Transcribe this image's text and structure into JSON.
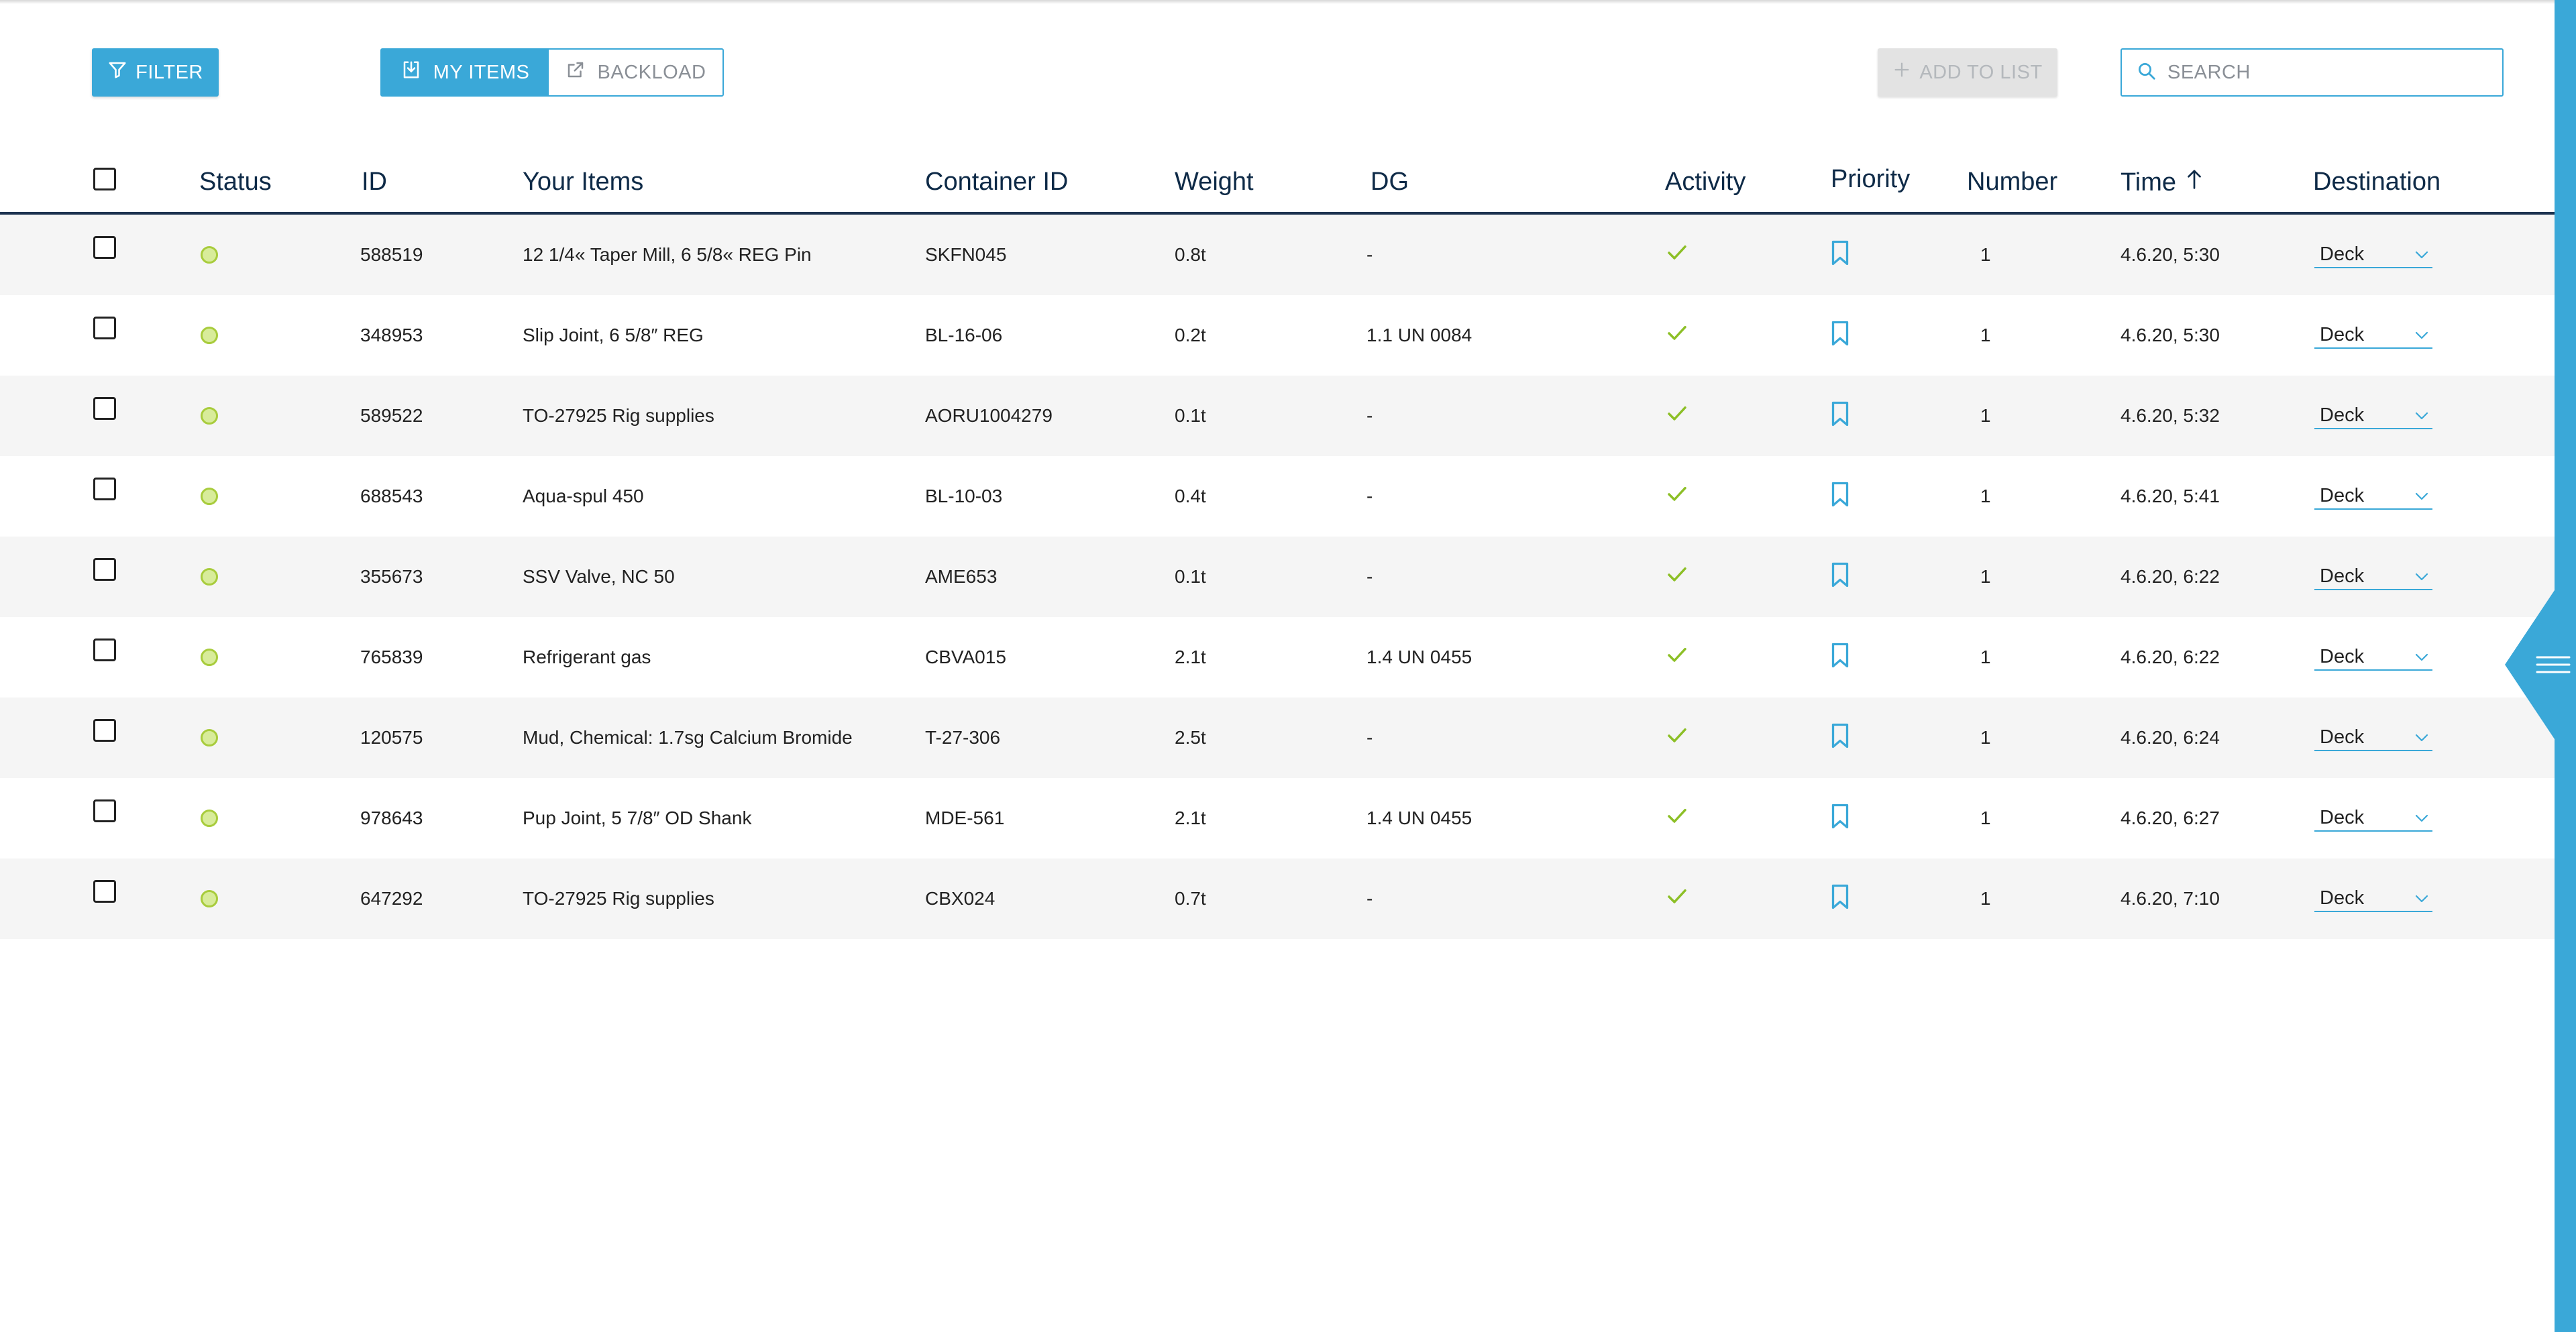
{
  "toolbar": {
    "filter_label": "FILTER",
    "my_items_label": "MY ITEMS",
    "backload_label": "BACKLOAD",
    "add_to_list_label": "ADD TO LIST",
    "search_placeholder": "SEARCH"
  },
  "table": {
    "headers": {
      "status": "Status",
      "id": "ID",
      "items": "Your Items",
      "container": "Container ID",
      "weight": "Weight",
      "dg": "DG",
      "activity": "Activity",
      "priority": "Priority",
      "number": "Number",
      "time": "Time",
      "destination": "Destination"
    },
    "sort": {
      "column": "time",
      "direction": "ascending",
      "icon": "arrow-up-icon"
    },
    "rows": [
      {
        "id": "588519",
        "item": "12 1/4« Taper Mill, 6 5/8« REG Pin",
        "container": "SKFN045",
        "weight": "0.8t",
        "dg": "-",
        "number": "1",
        "time": "4.6.20, 5:30",
        "destination": "Deck"
      },
      {
        "id": "348953",
        "item": "Slip Joint, 6 5/8″ REG",
        "container": "BL-16-06",
        "weight": "0.2t",
        "dg": "1.1 UN 0084",
        "number": "1",
        "time": "4.6.20, 5:30",
        "destination": "Deck"
      },
      {
        "id": "589522",
        "item": "TO-27925 Rig supplies",
        "container": "AORU1004279",
        "weight": "0.1t",
        "dg": "-",
        "number": "1",
        "time": "4.6.20, 5:32",
        "destination": "Deck"
      },
      {
        "id": "688543",
        "item": "Aqua-spul 450",
        "container": "BL-10-03",
        "weight": "0.4t",
        "dg": "-",
        "number": "1",
        "time": "4.6.20, 5:41",
        "destination": "Deck"
      },
      {
        "id": "355673",
        "item": "SSV Valve, NC 50",
        "container": "AME653",
        "weight": "0.1t",
        "dg": "-",
        "number": "1",
        "time": "4.6.20, 6:22",
        "destination": "Deck"
      },
      {
        "id": "765839",
        "item": "Refrigerant gas",
        "container": "CBVA015",
        "weight": "2.1t",
        "dg": "1.4 UN 0455",
        "number": "1",
        "time": "4.6.20, 6:22",
        "destination": "Deck"
      },
      {
        "id": "120575",
        "item": "Mud, Chemical: 1.7sg Calcium Bromide",
        "container": "T-27-306",
        "weight": "2.5t",
        "dg": "-",
        "number": "1",
        "time": "4.6.20, 6:24",
        "destination": "Deck"
      },
      {
        "id": "978643",
        "item": "Pup Joint, 5 7/8″ OD Shank",
        "container": "MDE-561",
        "weight": "2.1t",
        "dg": "1.4 UN 0455",
        "number": "1",
        "time": "4.6.20, 6:27",
        "destination": "Deck"
      },
      {
        "id": "647292",
        "item": "TO-27925 Rig supplies",
        "container": "CBX024",
        "weight": "0.7t",
        "dg": "-",
        "number": "1",
        "time": "4.6.20, 7:10",
        "destination": "Deck"
      }
    ]
  },
  "colors": {
    "accent": "#3aa8d8",
    "header_text": "#0e2a47",
    "status_fill": "#d8ec9a",
    "status_border": "#a8cc3c",
    "activity_check": "#8cbf26",
    "row_stripe": "#f5f5f5"
  },
  "icons": {
    "filter": "funnel-icon",
    "my_items": "download-tray-icon",
    "backload": "external-link-icon",
    "add": "plus-icon",
    "search": "magnifier-icon",
    "activity": "checkmark-icon",
    "priority": "bookmark-icon",
    "destination_dropdown": "chevron-down-icon",
    "side_menu": "hamburger-icon"
  }
}
